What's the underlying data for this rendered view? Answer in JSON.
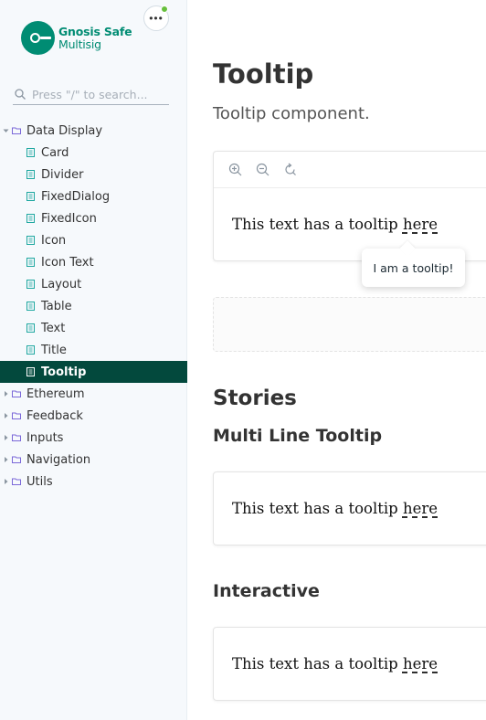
{
  "brand": {
    "name": "Gnosis Safe",
    "subtitle": "Multisig",
    "color": "#008c73"
  },
  "menu": {
    "label": "•••",
    "status_color": "#66bf3c"
  },
  "search": {
    "placeholder": "Press \"/\" to search..."
  },
  "sidebar": {
    "groups": [
      {
        "label": "Data Display",
        "expanded": true,
        "icon": "folder-icon"
      },
      {
        "label": "Ethereum",
        "expanded": false,
        "icon": "folder-icon"
      },
      {
        "label": "Feedback",
        "expanded": false,
        "icon": "folder-icon"
      },
      {
        "label": "Inputs",
        "expanded": false,
        "icon": "folder-icon"
      },
      {
        "label": "Navigation",
        "expanded": false,
        "icon": "folder-icon"
      },
      {
        "label": "Utils",
        "expanded": false,
        "icon": "folder-icon"
      }
    ],
    "data_display_items": [
      "Card",
      "Divider",
      "FixedDialog",
      "FixedIcon",
      "Icon",
      "Icon Text",
      "Layout",
      "Table",
      "Text",
      "Title",
      "Tooltip"
    ],
    "selected": "Tooltip",
    "selected_color": "#03493d"
  },
  "main": {
    "title": "Tooltip",
    "subtitle": "Tooltip component.",
    "toolbar": [
      "zoom-in-icon",
      "zoom-out-icon",
      "reset-zoom-icon"
    ],
    "preview": {
      "text": "This text has a tooltip",
      "link": "here"
    },
    "tooltip": {
      "text": "I am a tooltip!"
    },
    "stories_heading": "Stories",
    "stories": [
      {
        "title": "Multi Line Tooltip",
        "text": "This text has a tooltip",
        "link": "here"
      },
      {
        "title": "Interactive",
        "text": "This text has a tooltip",
        "link": "here"
      }
    ]
  }
}
